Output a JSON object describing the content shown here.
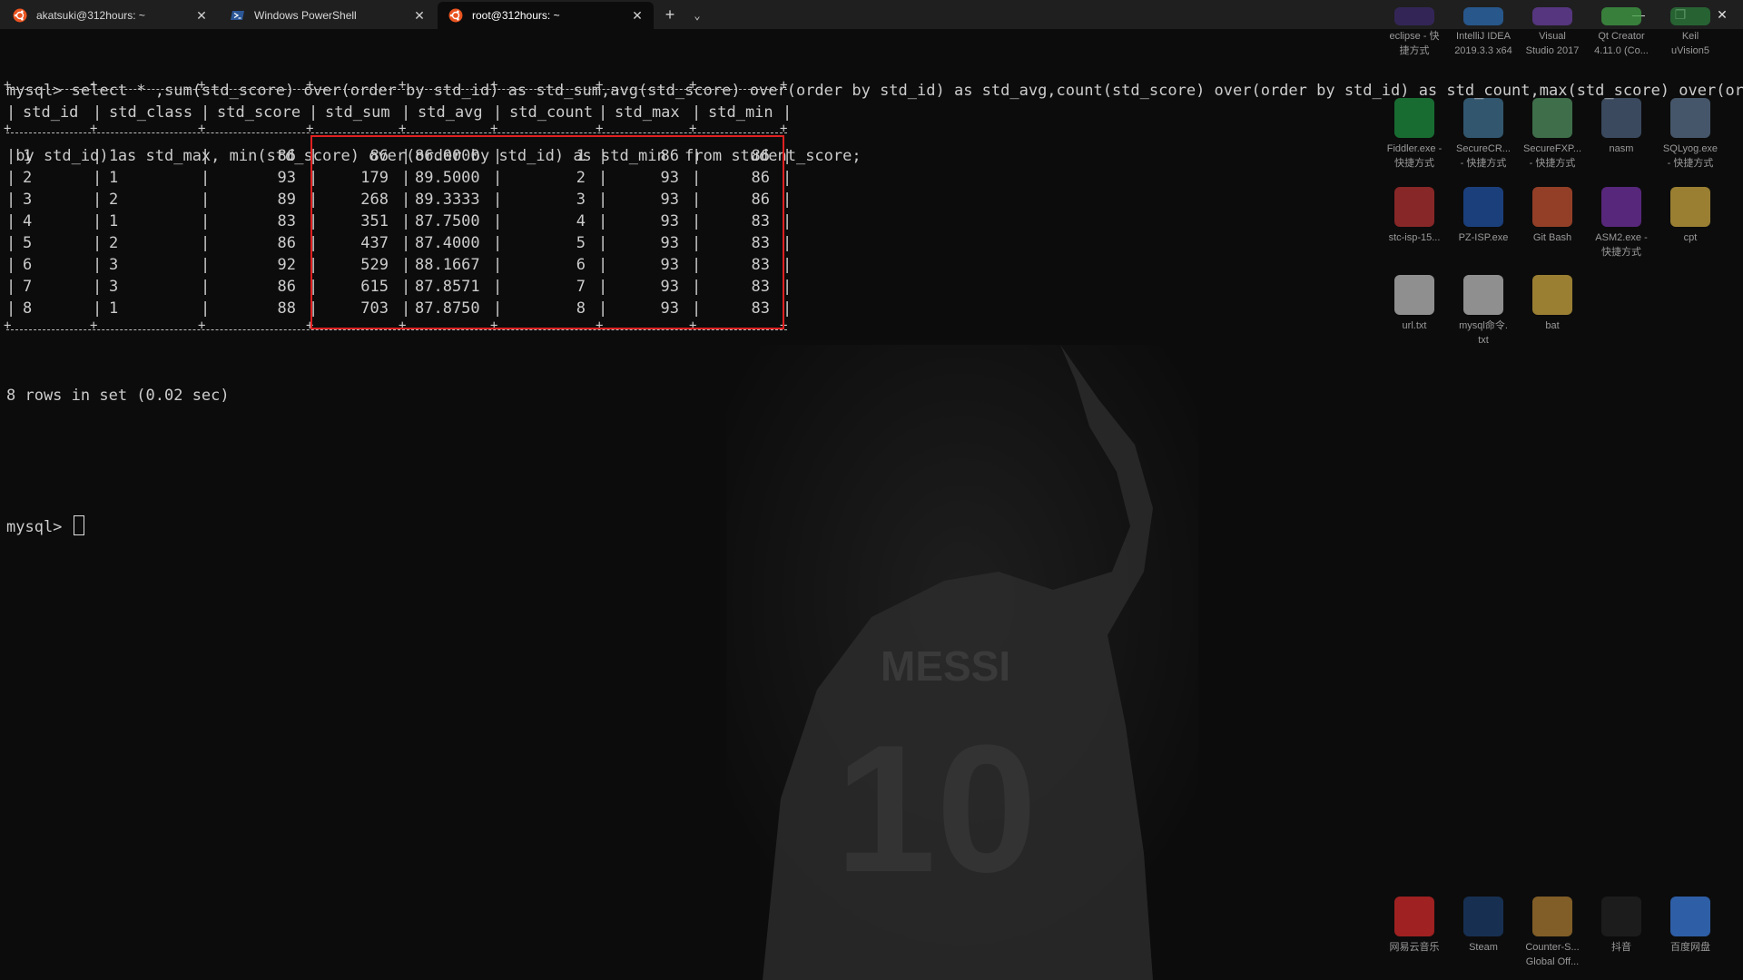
{
  "tabs": [
    {
      "label": "akatsuki@312hours: ~",
      "icon": "ubuntu-icon",
      "active": false
    },
    {
      "label": "Windows PowerShell",
      "icon": "powershell-icon",
      "active": false
    },
    {
      "label": "root@312hours: ~",
      "icon": "ubuntu-icon",
      "active": true
    }
  ],
  "tab_actions": {
    "add": "+",
    "dropdown": "⌄"
  },
  "window_controls": {
    "minimize": "—",
    "restore": "❐",
    "close": "✕"
  },
  "terminal": {
    "query_line1": "mysql> select * ,sum(std_score) over(order by std_id) as std_sum,avg(std_score) over(order by std_id) as std_avg,count(std_score) over(order by std_id) as std_count,max(std_score) over(order",
    "query_line2": " by std_id) as std_max, min(std_score) over(order by std_id) as std_min  from student_score;",
    "result_summary": "8 rows in set (0.02 sec)",
    "prompt": "mysql> "
  },
  "table": {
    "columns": [
      "std_id",
      "std_class",
      "std_score",
      "std_sum",
      "std_avg",
      "std_count",
      "std_max",
      "std_min"
    ],
    "rows": [
      [
        "1",
        "1",
        "86",
        "86",
        "86.0000",
        "1",
        "86",
        "86"
      ],
      [
        "2",
        "1",
        "93",
        "179",
        "89.5000",
        "2",
        "93",
        "86"
      ],
      [
        "3",
        "2",
        "89",
        "268",
        "89.3333",
        "3",
        "93",
        "86"
      ],
      [
        "4",
        "1",
        "83",
        "351",
        "87.7500",
        "4",
        "93",
        "83"
      ],
      [
        "5",
        "2",
        "86",
        "437",
        "87.4000",
        "5",
        "93",
        "83"
      ],
      [
        "6",
        "3",
        "92",
        "529",
        "88.1667",
        "6",
        "93",
        "83"
      ],
      [
        "7",
        "3",
        "86",
        "615",
        "87.8571",
        "7",
        "93",
        "83"
      ],
      [
        "8",
        "1",
        "88",
        "703",
        "87.8750",
        "8",
        "93",
        "83"
      ]
    ]
  },
  "desktop_icons": [
    {
      "label": "eclipse - 快\n捷方式",
      "icon": "eclipse-icon"
    },
    {
      "label": "IntelliJ IDEA\n2019.3.3 x64",
      "icon": "intellij-icon"
    },
    {
      "label": "Visual\nStudio 2017",
      "icon": "visual-studio-icon"
    },
    {
      "label": "Qt Creator\n4.11.0 (Co...",
      "icon": "qt-creator-icon"
    },
    {
      "label": "Keil\nuVision5",
      "icon": "keil-icon"
    },
    {
      "label": "Fiddler.exe -\n快捷方式",
      "icon": "fiddler-icon"
    },
    {
      "label": "SecureCR...\n- 快捷方式",
      "icon": "securecrt-icon"
    },
    {
      "label": "SecureFXP...\n- 快捷方式",
      "icon": "securefx-icon"
    },
    {
      "label": "nasm",
      "icon": "nasm-icon"
    },
    {
      "label": "SQLyog.exe\n- 快捷方式",
      "icon": "sqlyog-icon"
    },
    {
      "label": "stc-isp-15...",
      "icon": "stc-isp-icon"
    },
    {
      "label": "PZ-ISP.exe",
      "icon": "pz-isp-icon"
    },
    {
      "label": "Git Bash",
      "icon": "git-bash-icon"
    },
    {
      "label": "ASM2.exe -\n快捷方式",
      "icon": "asm2-icon"
    },
    {
      "label": "cpt",
      "icon": "folder-icon"
    },
    {
      "label": "url.txt",
      "icon": "text-file-icon"
    },
    {
      "label": "mysql命令.\ntxt",
      "icon": "text-file-icon"
    },
    {
      "label": "bat",
      "icon": "folder-icon"
    },
    {
      "label": "网易云音乐",
      "icon": "netease-music-icon"
    },
    {
      "label": "Steam",
      "icon": "steam-icon"
    },
    {
      "label": "Counter-S...\nGlobal Off...",
      "icon": "csgo-icon"
    },
    {
      "label": "抖音",
      "icon": "douyin-icon"
    },
    {
      "label": "百度网盘",
      "icon": "baidu-netdisk-icon"
    }
  ],
  "colors": {
    "terminal_bg": "#0c0c0c",
    "terminal_fg": "#cccccc",
    "highlight_box": "#e02020",
    "tabbar_bg": "#1f1f1f"
  }
}
